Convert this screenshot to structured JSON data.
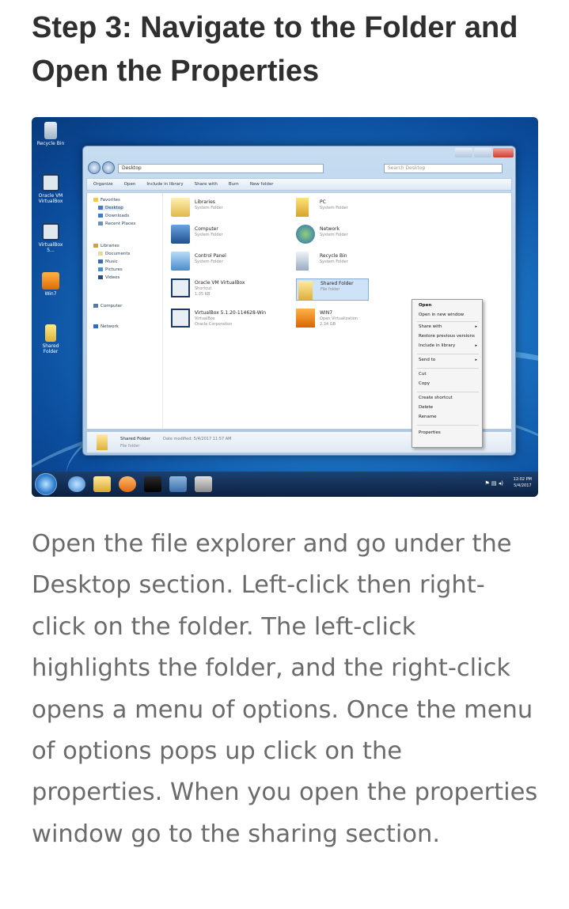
{
  "article": {
    "heading": "Step 3: Navigate to the Folder and Open the Properties",
    "body": "Open the file explorer and go under the Desktop section. Left-click then right-click on the folder. The left-click highlights the folder, and the right-click opens a menu of options. Once the menu of options pops up click on the properties. When you open the properties window go to the sharing section."
  },
  "screenshot": {
    "desktop_icons": [
      {
        "label": "Recycle Bin",
        "icon": "recycle-bin-icon"
      },
      {
        "label": "Oracle VM VirtualBox",
        "icon": "virtualbox-icon"
      },
      {
        "label": "VirtualBox 5...",
        "icon": "virtualbox-icon"
      },
      {
        "label": "Win7",
        "icon": "vm-box-icon"
      },
      {
        "label": "Shared Folder",
        "icon": "folder-icon"
      }
    ],
    "explorer": {
      "address": "Desktop",
      "search_placeholder": "Search Desktop",
      "toolbar": [
        "Organize",
        "Open",
        "Include in library",
        "Share with",
        "Burn",
        "New folder"
      ],
      "nav": {
        "favorites": "Favorites",
        "favorites_items": [
          "Desktop",
          "Downloads",
          "Recent Places"
        ],
        "libraries": "Libraries",
        "libraries_items": [
          "Documents",
          "Music",
          "Pictures",
          "Videos"
        ],
        "computer": "Computer",
        "network": "Network"
      },
      "items": [
        {
          "name": "Libraries",
          "sub": "System Folder",
          "icon": "libraries-icon"
        },
        {
          "name": "PC",
          "sub": "System Folder",
          "icon": "user-folder-icon"
        },
        {
          "name": "Computer",
          "sub": "System Folder",
          "icon": "computer-icon"
        },
        {
          "name": "Network",
          "sub": "System Folder",
          "icon": "network-icon"
        },
        {
          "name": "Control Panel",
          "sub": "System Folder",
          "icon": "control-panel-icon"
        },
        {
          "name": "Recycle Bin",
          "sub": "System Folder",
          "icon": "recycle-bin-icon"
        },
        {
          "name": "Oracle VM VirtualBox",
          "sub": "Shortcut",
          "sub2": "1.35 KB",
          "icon": "virtualbox-icon"
        },
        {
          "name": "Shared Folder",
          "sub": "File folder",
          "icon": "folder-icon"
        },
        {
          "name": "VirtualBox 5.1.20-114628-Win",
          "sub": "VirtualBox",
          "sub2": "Oracle Corporation",
          "icon": "virtualbox-icon"
        },
        {
          "name": "WIN7",
          "sub": "Open Virtualization",
          "sub2": "2.34 GB",
          "icon": "vm-box-icon"
        }
      ],
      "details": {
        "name": "Shared Folder",
        "modified": "Date modified: 5/4/2017 11:57 AM",
        "type": "File folder"
      }
    },
    "context_menu": [
      "Open",
      "Open in new window",
      "Share with",
      "Restore previous versions",
      "Include in library",
      "Send to",
      "Cut",
      "Copy",
      "Create shortcut",
      "Delete",
      "Rename",
      "Properties"
    ],
    "taskbar": {
      "time": "12:02 PM",
      "date": "5/4/2017"
    }
  }
}
